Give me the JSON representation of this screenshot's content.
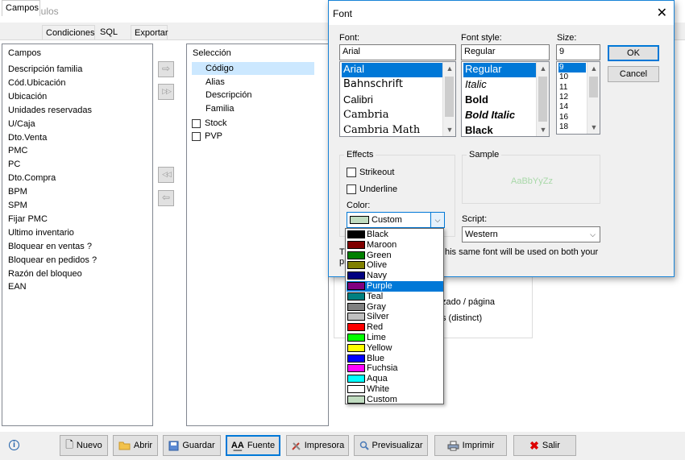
{
  "window": {
    "title": "Artículos"
  },
  "tabs": [
    "Campos",
    "Condiciones",
    "SQL",
    "Exportar"
  ],
  "campos_panel": {
    "header": "Campos",
    "items": [
      "Descripción familia",
      "Cód.Ubicación",
      "Ubicación",
      "Unidades reservadas",
      "U/Caja",
      "Dto.Venta",
      "PMC",
      "PC",
      "Dto.Compra",
      "BPM",
      "SPM",
      "Fijar PMC",
      "Ultimo inventario",
      "Bloquear en ventas ?",
      "Bloquear en pedidos ?",
      "Razón del bloqueo",
      "EAN"
    ]
  },
  "seleccion_panel": {
    "header": "Selección",
    "items": [
      "Código",
      "Alias",
      "Descripción",
      "Familia"
    ],
    "checks": [
      "Stock",
      "PVP"
    ]
  },
  "arrows": {
    "add": "⇨",
    "add_all": "▷▷",
    "remove_all": "◁◁",
    "remove": "⇦"
  },
  "background_fragments": {
    "line1": "zado / página",
    "line2": "s (distinct)"
  },
  "toolbar": {
    "nuevo": "Nuevo",
    "abrir": "Abrir",
    "guardar": "Guardar",
    "fuente": "Fuente",
    "impresora": "Impresora",
    "previsualizar": "Previsualizar",
    "imprimir": "Imprimir",
    "salir": "Salir"
  },
  "font_dialog": {
    "title": "Font",
    "font_label": "Font:",
    "font_value": "Arial",
    "fonts": [
      "Arial",
      "Bahnschrift",
      "Calibri",
      "Cambria",
      "Cambria Math"
    ],
    "style_label": "Font style:",
    "style_value": "Regular",
    "styles": [
      "Regular",
      "Italic",
      "Bold",
      "Bold Italic",
      "Black"
    ],
    "size_label": "Size:",
    "size_value": "9",
    "sizes": [
      "9",
      "10",
      "11",
      "12",
      "14",
      "16",
      "18"
    ],
    "ok": "OK",
    "cancel": "Cancel",
    "effects_label": "Effects",
    "strikeout": "Strikeout",
    "underline": "Underline",
    "color_label": "Color:",
    "color_value": "Custom",
    "sample_label": "Sample",
    "sample_text": "AaBbYyZz",
    "script_label": "Script:",
    "script_value": "Western",
    "info_prefix": "Th",
    "info_suffix": "his same font will be used on both your",
    "info_line2": "pr",
    "colors": [
      {
        "name": "Black",
        "hex": "#000000"
      },
      {
        "name": "Maroon",
        "hex": "#800000"
      },
      {
        "name": "Green",
        "hex": "#008000"
      },
      {
        "name": "Olive",
        "hex": "#808000"
      },
      {
        "name": "Navy",
        "hex": "#000080"
      },
      {
        "name": "Purple",
        "hex": "#800080"
      },
      {
        "name": "Teal",
        "hex": "#008080"
      },
      {
        "name": "Gray",
        "hex": "#808080"
      },
      {
        "name": "Silver",
        "hex": "#c0c0c0"
      },
      {
        "name": "Red",
        "hex": "#ff0000"
      },
      {
        "name": "Lime",
        "hex": "#00ff00"
      },
      {
        "name": "Yellow",
        "hex": "#ffff00"
      },
      {
        "name": "Blue",
        "hex": "#0000ff"
      },
      {
        "name": "Fuchsia",
        "hex": "#ff00ff"
      },
      {
        "name": "Aqua",
        "hex": "#00ffff"
      },
      {
        "name": "White",
        "hex": "#ffffff"
      },
      {
        "name": "Custom",
        "hex": "#c0dcc0"
      }
    ],
    "highlighted_color": "Purple"
  }
}
